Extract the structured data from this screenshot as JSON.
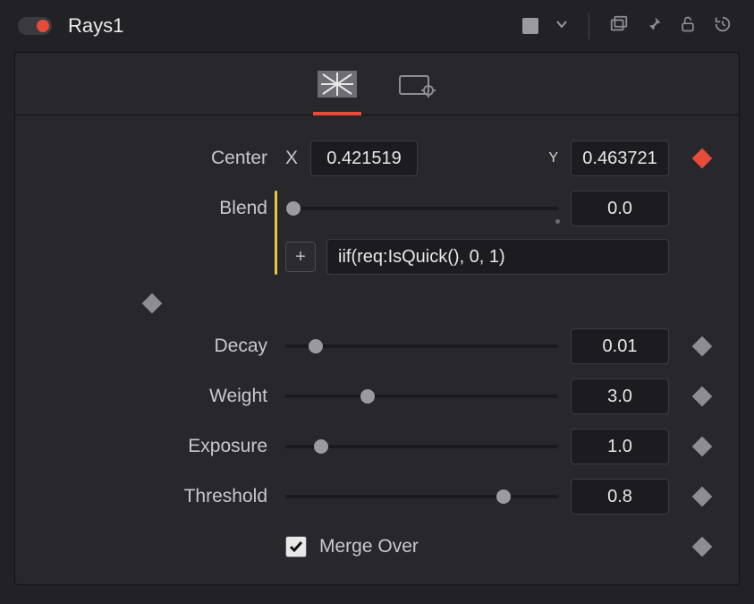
{
  "header": {
    "toggle_on": true,
    "title": "Rays1",
    "color_chip": "#9a9a9f"
  },
  "tabs": {
    "active_index": 0,
    "items": [
      "rays-tab",
      "settings-tab"
    ]
  },
  "params": {
    "center": {
      "label": "Center",
      "x_label": "X",
      "x_value": "0.421519",
      "y_label": "Y",
      "y_value": "0.463721",
      "keyframe": "red"
    },
    "blend": {
      "label": "Blend",
      "slider_pos": 0.0,
      "value": "0.0",
      "expression_enabled": true,
      "expression": "iif(req:IsQuick(), 0, 1)",
      "keyframe": "grey"
    },
    "decay": {
      "label": "Decay",
      "slider_pos": 0.11,
      "value": "0.01",
      "keyframe": "grey"
    },
    "weight": {
      "label": "Weight",
      "slider_pos": 0.3,
      "value": "3.0",
      "keyframe": "grey"
    },
    "exposure": {
      "label": "Exposure",
      "slider_pos": 0.13,
      "value": "1.0",
      "keyframe": "grey"
    },
    "threshold": {
      "label": "Threshold",
      "slider_pos": 0.8,
      "value": "0.8",
      "keyframe": "grey"
    },
    "merge_over": {
      "label": "Merge Over",
      "checked": true,
      "keyframe": "grey"
    }
  }
}
